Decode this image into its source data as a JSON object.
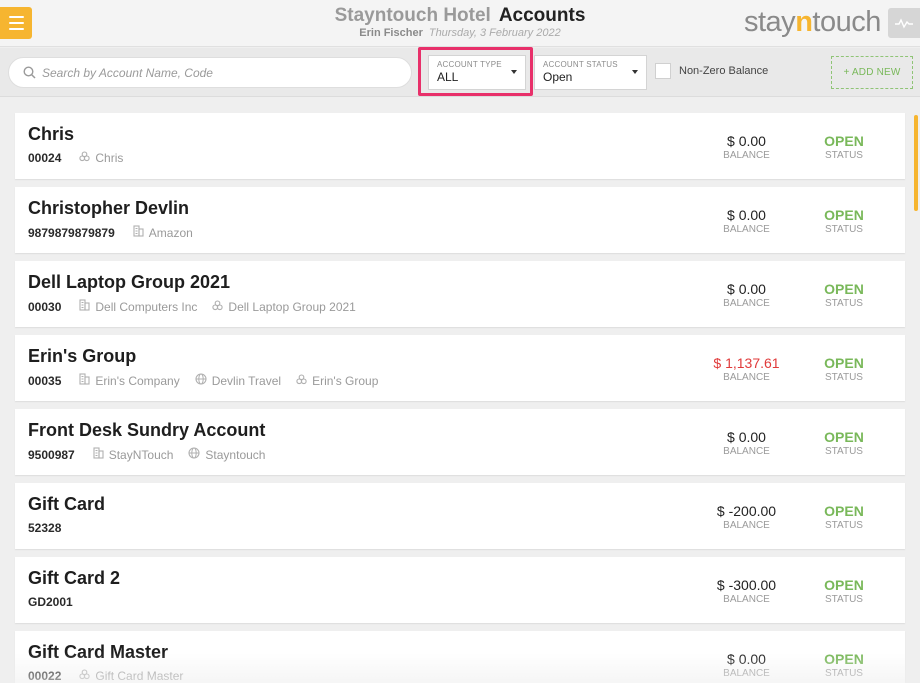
{
  "header": {
    "hotel_name": "Stayntouch Hotel",
    "page_title": "Accounts",
    "user_name": "Erin Fischer",
    "date": "Thursday, 3 February 2022",
    "logo_prefix": "stay",
    "logo_accent": "n",
    "logo_suffix": "touch"
  },
  "filters": {
    "search_placeholder": "Search by Account Name, Code",
    "account_type_label": "ACCOUNT TYPE",
    "account_type_value": "ALL",
    "account_status_label": "ACCOUNT STATUS",
    "account_status_value": "Open",
    "non_zero_label": "Non-Zero Balance",
    "add_new_label": "+ ADD NEW"
  },
  "labels": {
    "balance": "BALANCE",
    "status": "STATUS"
  },
  "colors": {
    "accent": "#f6b530",
    "open_status": "#79b85a",
    "negative_balance": "#e03a3a",
    "highlight": "#e8306a"
  },
  "accounts": [
    {
      "name": "Chris",
      "code": "00024",
      "tags": [
        {
          "icon": "group-icon",
          "text": "Chris"
        }
      ],
      "balance": "$ 0.00",
      "negative": false,
      "status": "OPEN"
    },
    {
      "name": "Christopher Devlin",
      "code": "9879879879879",
      "tags": [
        {
          "icon": "company-icon",
          "text": "Amazon"
        }
      ],
      "balance": "$ 0.00",
      "negative": false,
      "status": "OPEN"
    },
    {
      "name": "Dell Laptop Group 2021",
      "code": "00030",
      "tags": [
        {
          "icon": "company-icon",
          "text": "Dell Computers Inc"
        },
        {
          "icon": "group-icon",
          "text": "Dell Laptop Group 2021"
        }
      ],
      "balance": "$ 0.00",
      "negative": false,
      "status": "OPEN"
    },
    {
      "name": "Erin's Group",
      "code": "00035",
      "tags": [
        {
          "icon": "company-icon",
          "text": "Erin's Company"
        },
        {
          "icon": "globe-icon",
          "text": "Devlin Travel"
        },
        {
          "icon": "group-icon",
          "text": "Erin's Group"
        }
      ],
      "balance": "$ 1,137.61",
      "negative": true,
      "status": "OPEN"
    },
    {
      "name": "Front Desk Sundry Account",
      "code": "9500987",
      "tags": [
        {
          "icon": "company-icon",
          "text": "StayNTouch"
        },
        {
          "icon": "globe-icon",
          "text": "Stayntouch"
        }
      ],
      "balance": "$ 0.00",
      "negative": false,
      "status": "OPEN"
    },
    {
      "name": "Gift Card",
      "code": "52328",
      "tags": [],
      "balance": "$ -200.00",
      "negative": false,
      "status": "OPEN"
    },
    {
      "name": "Gift Card 2",
      "code": "GD2001",
      "tags": [],
      "balance": "$ -300.00",
      "negative": false,
      "status": "OPEN"
    },
    {
      "name": "Gift Card Master",
      "code": "00022",
      "tags": [
        {
          "icon": "group-icon",
          "text": "Gift Card Master"
        }
      ],
      "balance": "$ 0.00",
      "negative": false,
      "status": "OPEN"
    }
  ]
}
